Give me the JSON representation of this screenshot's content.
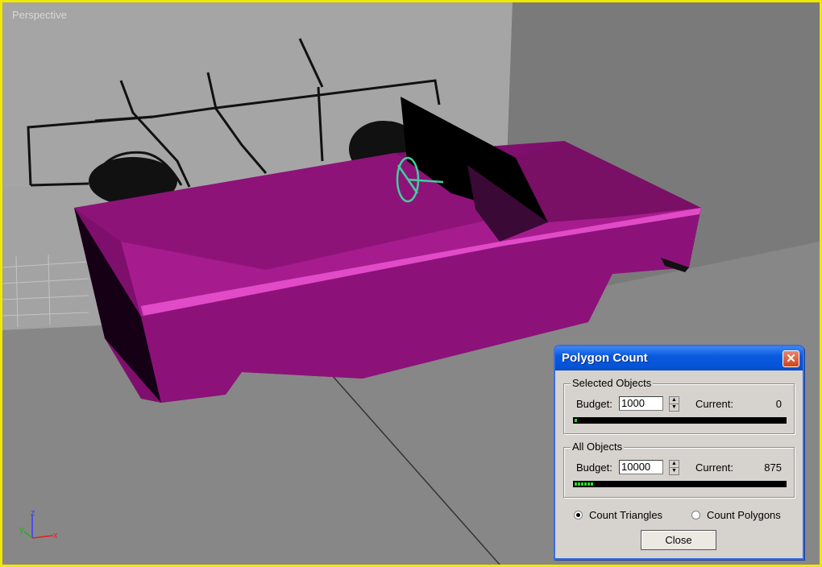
{
  "viewport": {
    "label": "Perspective",
    "border_color": "#f0e800",
    "model_color": "#9b1585",
    "gizmo_axes": {
      "z": "z",
      "y": "y",
      "x": "x"
    }
  },
  "dialog": {
    "title": "Polygon Count",
    "close_icon": "close-icon",
    "selected_group": {
      "legend": "Selected Objects",
      "budget_label": "Budget:",
      "budget_value": "1000",
      "current_label": "Current:",
      "current_value": "0",
      "bar_fill_fraction": 0.0
    },
    "all_group": {
      "legend": "All Objects",
      "budget_label": "Budget:",
      "budget_value": "10000",
      "current_label": "Current:",
      "current_value": "875",
      "bar_fill_fraction": 0.0875
    },
    "options": [
      {
        "label": "Count Triangles",
        "selected": true
      },
      {
        "label": "Count Polygons",
        "selected": false
      }
    ],
    "close_button": "Close"
  }
}
